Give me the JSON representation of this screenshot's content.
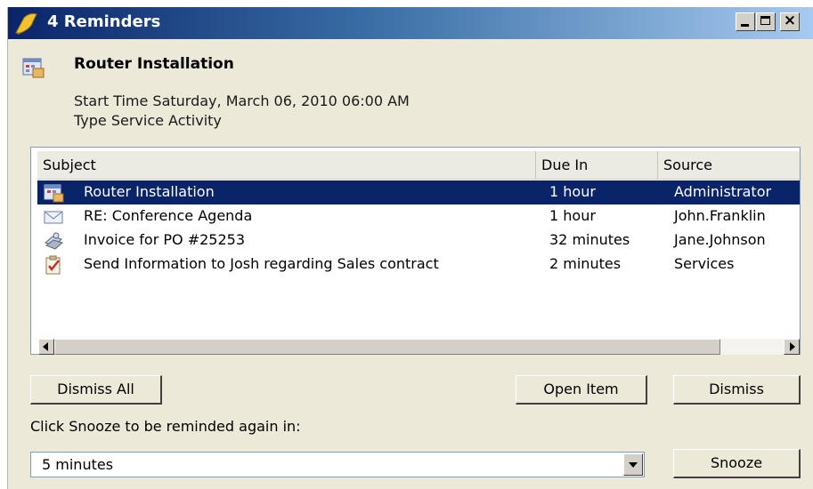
{
  "window": {
    "title": "4 Reminders"
  },
  "header": {
    "title": "Router Installation",
    "start_time": "Start Time Saturday, March 06, 2010 06:00 AM",
    "type": "Type Service Activity"
  },
  "list": {
    "columns": [
      "Subject",
      "Due In",
      "Source"
    ],
    "rows": [
      {
        "icon": "service-activity-icon",
        "subject": "Router Installation",
        "due_in": "1 hour",
        "source": "Administrator",
        "selected": true
      },
      {
        "icon": "email-icon",
        "subject": "RE:  Conference Agenda",
        "due_in": "1 hour",
        "source": "John.Franklin",
        "selected": false
      },
      {
        "icon": "invoice-icon",
        "subject": "Invoice for PO #25253",
        "due_in": "32 minutes",
        "source": "Jane.Johnson",
        "selected": false
      },
      {
        "icon": "task-icon",
        "subject": "Send Information to Josh regarding Sales contract",
        "due_in": "2 minutes",
        "source": "Services",
        "selected": false
      }
    ]
  },
  "buttons": {
    "dismiss_all": "Dismiss All",
    "open_item": "Open Item",
    "dismiss": "Dismiss",
    "snooze": "Snooze"
  },
  "snooze": {
    "label": "Click Snooze to be reminded again in:",
    "selected_value": "5 minutes"
  },
  "colors": {
    "selection": "#0a246a",
    "dialog_bg": "#ece9d8"
  }
}
